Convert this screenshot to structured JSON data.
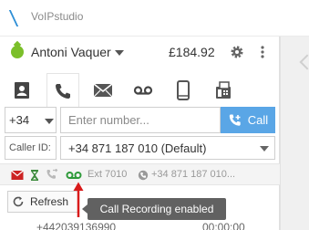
{
  "window": {
    "title": "VoIPstudio"
  },
  "account": {
    "name": "Antoni Vaquer",
    "balance": "£184.92"
  },
  "tabs": [
    {
      "name": "contacts",
      "icon": "contacts-icon",
      "active": false
    },
    {
      "name": "dialer",
      "icon": "phone-icon",
      "active": true
    },
    {
      "name": "messages",
      "icon": "envelope-icon",
      "active": false
    },
    {
      "name": "voicemail",
      "icon": "voicemail-icon",
      "active": false
    },
    {
      "name": "mobile",
      "icon": "mobile-icon",
      "active": false
    },
    {
      "name": "fax",
      "icon": "fax-icon",
      "active": false
    }
  ],
  "dialer": {
    "country_code": "+34",
    "number_placeholder": "Enter number...",
    "call_label": "Call",
    "caller_id_label": "Caller ID:",
    "caller_id_value": "+34 871 187 010 (Default)"
  },
  "status_bar": {
    "extension": "Ext 7010",
    "cli": "+34 871 187 010..."
  },
  "toolbar": {
    "refresh_label": "Refresh"
  },
  "list": {
    "row_partial_left": "+442039136990",
    "row_partial_right": "00:00:00"
  },
  "tooltip": {
    "text": "Call Recording enabled"
  },
  "colors": {
    "accent": "#5aa6e6",
    "online": "#7bbf2a",
    "recording": "#2e9a3a",
    "voicemail_alert": "#cc2222",
    "tooltip_bg": "#616161",
    "arrow": "#d81b1b"
  }
}
